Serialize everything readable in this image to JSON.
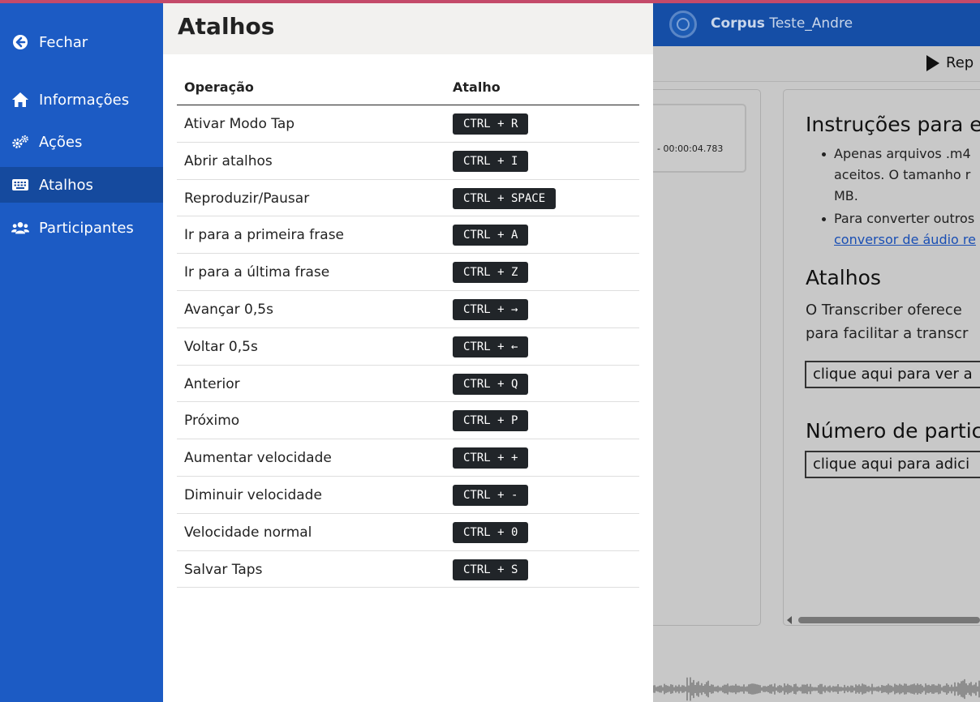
{
  "sidebar": {
    "items": [
      {
        "label": "Fechar",
        "icon": "arrow-circle-left-icon"
      },
      {
        "label": "Informações",
        "icon": "home-icon"
      },
      {
        "label": "Ações",
        "icon": "gears-icon"
      },
      {
        "label": "Atalhos",
        "icon": "keyboard-icon",
        "active": true
      },
      {
        "label": "Participantes",
        "icon": "users-icon"
      }
    ]
  },
  "modal": {
    "title": "Atalhos",
    "columns": [
      "Operação",
      "Atalho"
    ],
    "rows": [
      {
        "operation": "Ativar Modo Tap",
        "shortcut": "CTRL + R"
      },
      {
        "operation": "Abrir atalhos",
        "shortcut": "CTRL + I"
      },
      {
        "operation": "Reproduzir/Pausar",
        "shortcut": "CTRL + SPACE"
      },
      {
        "operation": "Ir para a primeira frase",
        "shortcut": "CTRL + A"
      },
      {
        "operation": "Ir para a última frase",
        "shortcut": "CTRL + Z"
      },
      {
        "operation": "Avançar 0,5s",
        "shortcut": "CTRL + →"
      },
      {
        "operation": "Voltar 0,5s",
        "shortcut": "CTRL + ←"
      },
      {
        "operation": "Anterior",
        "shortcut": "CTRL + Q"
      },
      {
        "operation": "Próximo",
        "shortcut": "CTRL + P"
      },
      {
        "operation": "Aumentar velocidade",
        "shortcut": "CTRL + +"
      },
      {
        "operation": "Diminuir velocidade",
        "shortcut": "CTRL + -"
      },
      {
        "operation": "Velocidade normal",
        "shortcut": "CTRL + 0"
      },
      {
        "operation": "Salvar Taps",
        "shortcut": "CTRL + S"
      }
    ]
  },
  "background": {
    "corpus_label": "Corpus",
    "corpus_name": "Teste_Andre",
    "play_label": "Rep",
    "segment_time": "-   00:00:04.783",
    "instructions_title": "Instruções para e",
    "bullet1_line1": "Apenas arquivos .m4",
    "bullet1_line2": "aceitos. O tamanho r",
    "bullet1_line3": "MB.",
    "bullet2_line1": "Para converter outros",
    "bullet2_link": "conversor de áudio re",
    "atalhos_title": "Atalhos",
    "atalhos_text1": "O Transcriber oferece",
    "atalhos_text2": "para facilitar a transcr",
    "atalhos_button": "clique aqui para ver a",
    "participants_title": "Número de partic",
    "participants_button": "clique aqui para adici"
  },
  "colors": {
    "sidebar": "#1c5bc4",
    "sidebar_active": "#154a9e",
    "kbd_bg": "#212529",
    "header_bg": "#154ea6",
    "overlay_bg": "#c8c8c8"
  }
}
